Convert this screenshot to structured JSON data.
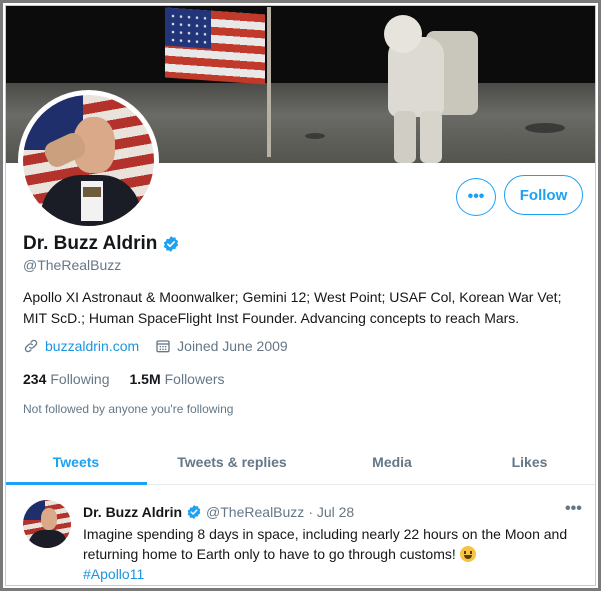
{
  "profile": {
    "name": "Dr. Buzz Aldrin",
    "handle": "@TheRealBuzz",
    "bio": "Apollo XI Astronaut & Moonwalker; Gemini 12; West Point; USAF Col, Korean War Vet; MIT ScD.; Human SpaceFlight Inst Founder. Advancing concepts to reach Mars.",
    "website": "buzzaldrin.com",
    "joined": "Joined June 2009",
    "following_count": "234",
    "following_label": "Following",
    "followers_count": "1.5M",
    "followers_label": "Followers",
    "not_followed_note": "Not followed by anyone you're following",
    "verified": true
  },
  "actions": {
    "more_label": "•••",
    "follow_label": "Follow"
  },
  "tabs": [
    {
      "label": "Tweets",
      "active": true
    },
    {
      "label": "Tweets & replies",
      "active": false
    },
    {
      "label": "Media",
      "active": false
    },
    {
      "label": "Likes",
      "active": false
    }
  ],
  "tweet": {
    "author_name": "Dr. Buzz Aldrin",
    "author_handle": "@TheRealBuzz",
    "date": "· Jul 28",
    "more_label": "•••",
    "text": "Imagine spending 8 days in space, including nearly 22 hours on the Moon and returning home to Earth only to have to go through customs!",
    "hashtag": "#Apollo11"
  },
  "icons": {
    "verified": "verified-badge-icon",
    "link": "link-icon",
    "calendar": "calendar-icon",
    "emoji": "grinning-face-emoji"
  },
  "colors": {
    "accent": "#1da1f2",
    "link": "#1b95e0",
    "muted": "#657786",
    "text": "#14171a"
  }
}
